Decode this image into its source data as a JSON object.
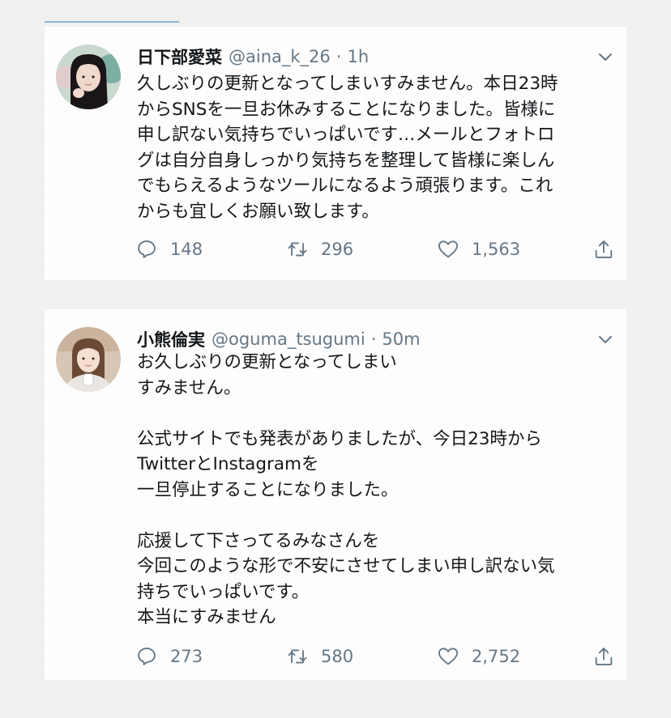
{
  "tweets": [
    {
      "name": "日下部愛菜",
      "handle": "@aina_k_26",
      "separator": "·",
      "time": "1h",
      "lines": [
        "久しぶりの更新となってしまいすみません。本日23時",
        "からSNSを一旦お休みすることになりました。皆様に",
        "申し訳ない気持ちでいっぱいです…メールとフォトロ",
        "グは自分自身しっかり気持ちを整理して皆様に楽しん",
        "でもらえるようなツールになるよう頑張ります。これ",
        "からも宜しくお願い致します。"
      ],
      "replies": "148",
      "retweets": "296",
      "likes": "1,563",
      "avatar_colors": {
        "bg": "#c9d9cf",
        "hair": "#1a1618",
        "skin": "#f1d8cc",
        "accent": "#5c9b8e"
      }
    },
    {
      "name": "小熊倫実",
      "handle": "@oguma_tsugumi",
      "separator": "·",
      "time": "50m",
      "lines": [
        "お久しぶりの更新となってしまい",
        "すみません。",
        "",
        "公式サイトでも発表がありましたが、今日23時から",
        "TwitterとInstagramを",
        "一旦停止することになりました。",
        "",
        "応援して下さってるみなさんを",
        "今回このような形で不安にさせてしまい申し訳ない気",
        "持ちでいっぱいです。",
        "本当にすみません"
      ],
      "replies": "273",
      "retweets": "580",
      "likes": "2,752",
      "avatar_colors": {
        "bg": "#d8c6b4",
        "hair": "#6a4a36",
        "skin": "#f4dfd1",
        "accent": "#e9e6e3"
      }
    }
  ],
  "icons": {
    "reply": "reply-icon",
    "retweet": "retweet-icon",
    "like": "heart-icon",
    "share": "share-icon",
    "menu": "chevron-down-icon"
  },
  "colors": {
    "text": "#14171a",
    "secondary": "#657786",
    "card": "#fdfdfd",
    "page": "#f2f2f1"
  }
}
